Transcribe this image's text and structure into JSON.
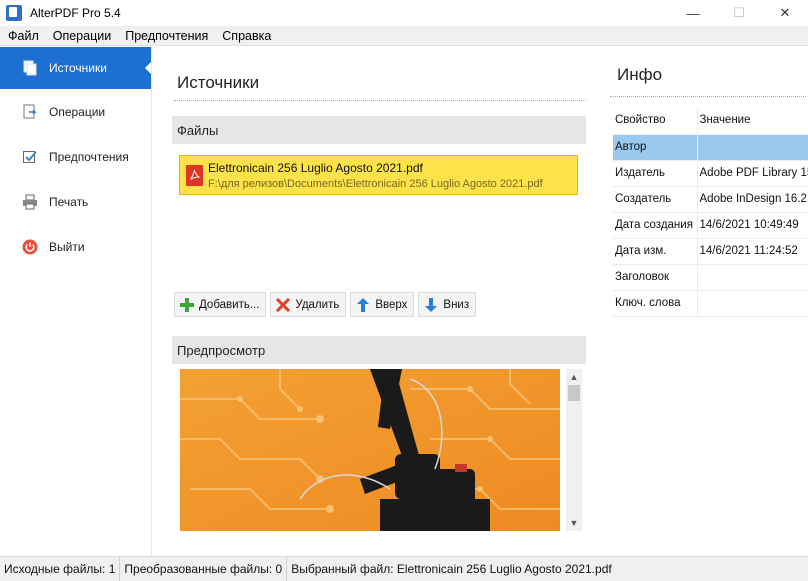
{
  "window": {
    "title": "AlterPDF Pro 5.4",
    "minimize_glyph": "—",
    "maximize_glyph": "☐",
    "close_glyph": "✕"
  },
  "menu": [
    "Файл",
    "Операции",
    "Предпочтения",
    "Справка"
  ],
  "sidebar": {
    "items": [
      {
        "label": "Источники",
        "icon": "sources-icon",
        "active": true
      },
      {
        "label": "Операции",
        "icon": "operations-icon",
        "active": false
      },
      {
        "label": "Предпочтения",
        "icon": "preferences-icon",
        "active": false
      },
      {
        "label": "Печать",
        "icon": "printer-icon",
        "active": false
      },
      {
        "label": "Выйти",
        "icon": "power-icon",
        "active": false
      }
    ]
  },
  "main": {
    "title": "Источники",
    "files_header": "Файлы",
    "files": [
      {
        "name": "Elettronicain 256 Luglio Agosto 2021.pdf",
        "path": "F:\\для релизов\\Documents\\Elettronicain 256 Luglio Agosto 2021.pdf"
      }
    ],
    "buttons": {
      "add": "Добавить...",
      "delete": "Удалить",
      "up": "Вверх",
      "down": "Вниз"
    },
    "preview_header": "Предпросмотр"
  },
  "info": {
    "title": "Инфо",
    "columns": [
      "Свойство",
      "Значение"
    ],
    "rows": [
      {
        "prop": "Автор",
        "value": ""
      },
      {
        "prop": "Издатель",
        "value": "Adobe PDF Library 15"
      },
      {
        "prop": "Создатель",
        "value": "Adobe InDesign 16.2"
      },
      {
        "prop": "Дата создания",
        "value": "14/6/2021 10:49:49"
      },
      {
        "prop": "Дата изм.",
        "value": "14/6/2021 11:24:52"
      },
      {
        "prop": "Заголовок",
        "value": ""
      },
      {
        "prop": "Ключ. слова",
        "value": ""
      }
    ]
  },
  "status": {
    "source_files": "Исходные файлы: 1",
    "converted_files": "Преобразованные файлы: 0",
    "selected_file": "Выбранный файл: Elettronicain 256 Luglio Agosto 2021.pdf"
  },
  "colors": {
    "accent": "#1d6fd1",
    "file_highlight": "#fde24a",
    "selected_row": "#99c9ef"
  }
}
